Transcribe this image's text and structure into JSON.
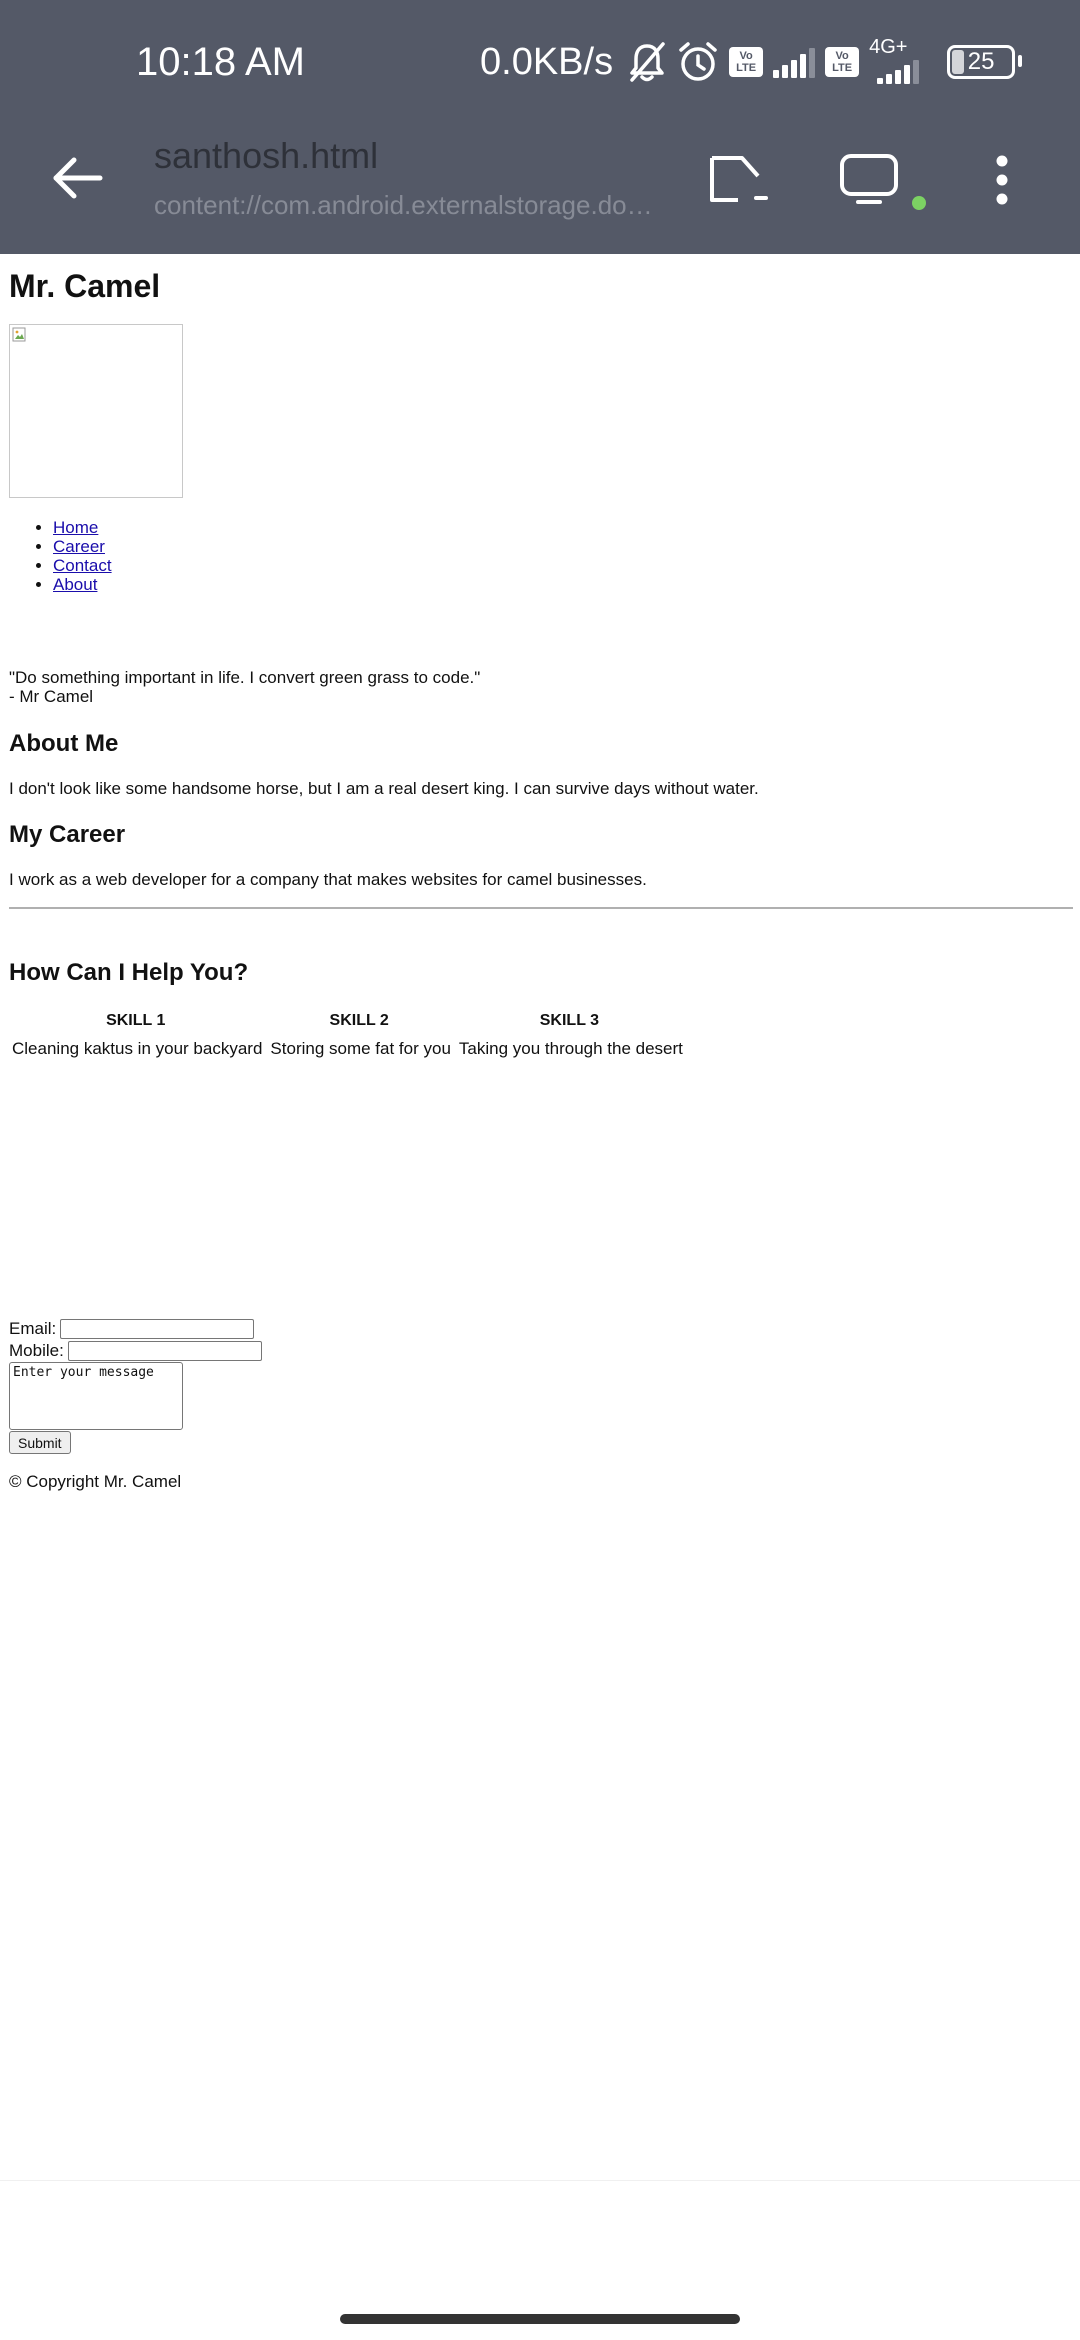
{
  "status_bar": {
    "time": "10:18 AM",
    "net_speed": "0.0KB/s",
    "lte_badge": "Vo LTE",
    "network_type": "4G+",
    "battery_level": "25",
    "icons": [
      "bell-off-icon",
      "alarm-icon",
      "volte-icon",
      "signal-icon",
      "volte-icon",
      "signal-4g-icon",
      "battery-icon"
    ]
  },
  "app_bar": {
    "back_icon": "arrow-left-icon",
    "title": "santhosh.html",
    "url": "content://com.android.externalstorage.docu...",
    "actions": [
      "open-in-icon",
      "desktop-view-icon",
      "more-vert-icon"
    ],
    "status_dot_color": "#7cd263"
  },
  "document": {
    "heading": "Mr. Camel",
    "nav": [
      "Home",
      "Career",
      "Contact",
      "About"
    ],
    "quote": "\"Do something important in life. I convert green grass to code.\"",
    "quote_author": "- Mr Camel",
    "about": {
      "heading": "About Me",
      "text": "I don't look like some handsome horse, but I am a real desert king. I can survive days without water."
    },
    "career": {
      "heading": "My Career",
      "text": "I work as a web developer for a company that makes websites for camel businesses."
    },
    "help": {
      "heading": "How Can I Help You?",
      "skill_headers": [
        "SKILL 1",
        "SKILL 2",
        "SKILL 3"
      ],
      "skills": [
        "Cleaning kaktus in your backyard",
        "Storing some fat for you",
        "Taking you through the desert"
      ]
    },
    "form": {
      "email_label": "Email:",
      "mobile_label": "Mobile:",
      "message_placeholder": "Enter your message",
      "submit_label": "Submit"
    },
    "footer": "© Copyright Mr. Camel"
  },
  "colors": {
    "app_bar_bg": "#545967",
    "link": "#1a0dab"
  }
}
